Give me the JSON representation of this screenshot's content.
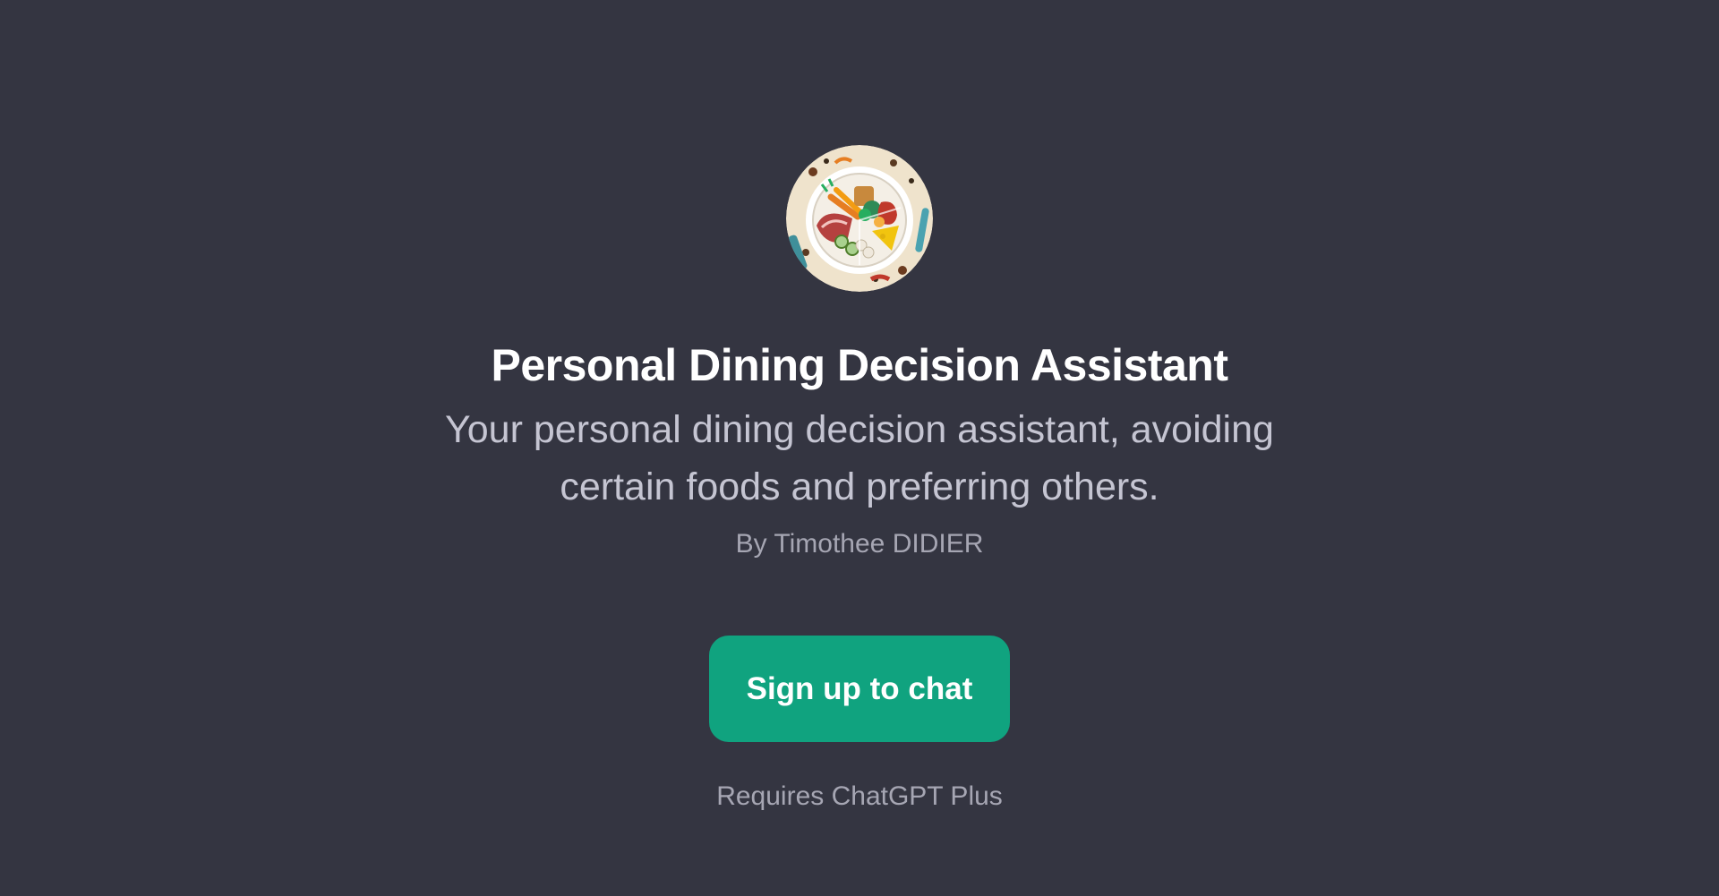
{
  "gpt": {
    "avatar_icon": "food-plate-icon",
    "title": "Personal Dining Decision Assistant",
    "description": "Your personal dining decision assistant, avoiding certain foods and preferring others.",
    "author": "By Timothee DIDIER"
  },
  "cta": {
    "button_label": "Sign up to chat",
    "requirement": "Requires ChatGPT Plus"
  },
  "colors": {
    "background": "#343541",
    "accent": "#10a37f",
    "title": "#ffffff",
    "description": "#c5c5d2",
    "muted": "#a6a6b3"
  }
}
